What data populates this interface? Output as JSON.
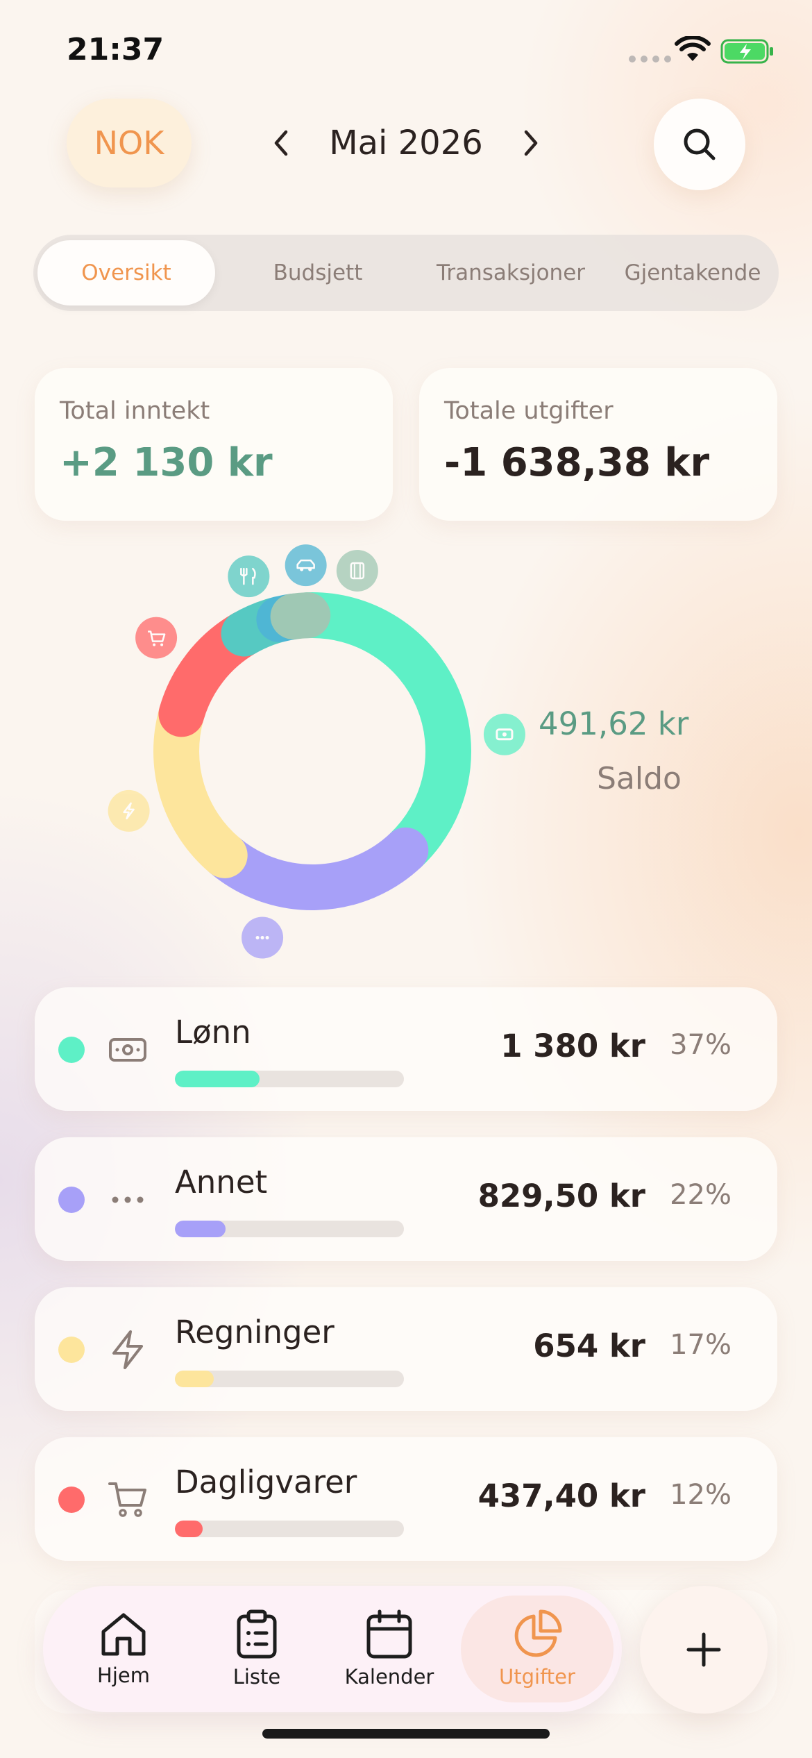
{
  "status_bar": {
    "time": "21:37"
  },
  "header": {
    "currency": "NOK",
    "month": "Mai 2026"
  },
  "tabs": [
    {
      "label": "Oversikt",
      "active": true
    },
    {
      "label": "Budsjett",
      "active": false
    },
    {
      "label": "Transaksjoner",
      "active": false
    },
    {
      "label": "Gjentakende",
      "active": false
    }
  ],
  "summary": {
    "income_label": "Total inntekt",
    "income_value": "+2 130 kr",
    "expense_label": "Totale utgifter",
    "expense_value": "-1 638,38 kr"
  },
  "balance": {
    "value": "491,62 kr",
    "label": "Saldo"
  },
  "colors": {
    "accent": "#f0954e",
    "income": "#5a9b83",
    "lonn": "#5ef0c6",
    "annet": "#a7a0f8",
    "regninger": "#fde59c",
    "dagligvarer": "#ff6b6b",
    "restaurant": "#56c9c2",
    "transport": "#4fb6d4",
    "underholdning": "#9fc8b4"
  },
  "chart_data": {
    "type": "pie",
    "donut": true,
    "title": "",
    "slices": [
      {
        "name": "Lønn",
        "value": 1380,
        "percent": 37,
        "color": "#5ef0c6",
        "icon": "banknote-icon"
      },
      {
        "name": "Annet",
        "value": 829.5,
        "percent": 22,
        "color": "#a7a0f8",
        "icon": "more-icon"
      },
      {
        "name": "Regninger",
        "value": 654,
        "percent": 17,
        "color": "#fde59c",
        "icon": "bolt-icon"
      },
      {
        "name": "Dagligvarer",
        "value": 437.4,
        "percent": 12,
        "color": "#ff6b6b",
        "icon": "cart-icon"
      },
      {
        "name": "",
        "value": 160,
        "percent": 4,
        "color": "#56c9c2",
        "icon": "fork-knife-icon"
      },
      {
        "name": "",
        "value": 60,
        "percent": 2,
        "color": "#4fb6d4",
        "icon": "car-icon"
      },
      {
        "name": "",
        "value": 60,
        "percent": 2,
        "color": "#9fc8b4",
        "icon": "film-icon"
      }
    ]
  },
  "categories": [
    {
      "name": "Lønn",
      "amount": "1 380 kr",
      "percent": "37%",
      "fill": 0.37,
      "color": "#5ef0c6",
      "icon": "banknote-icon"
    },
    {
      "name": "Annet",
      "amount": "829,50 kr",
      "percent": "22%",
      "fill": 0.22,
      "color": "#a7a0f8",
      "icon": "more-icon"
    },
    {
      "name": "Regninger",
      "amount": "654 kr",
      "percent": "17%",
      "fill": 0.17,
      "color": "#fde59c",
      "icon": "bolt-icon"
    },
    {
      "name": "Dagligvarer",
      "amount": "437,40 kr",
      "percent": "12%",
      "fill": 0.12,
      "color": "#ff6b6b",
      "icon": "cart-icon"
    }
  ],
  "tabbar": [
    {
      "label": "Hjem",
      "icon": "home-icon",
      "active": false
    },
    {
      "label": "Liste",
      "icon": "clipboard-list-icon",
      "active": false
    },
    {
      "label": "Kalender",
      "icon": "calendar-icon",
      "active": false
    },
    {
      "label": "Utgifter",
      "icon": "pie-chart-icon",
      "active": true
    }
  ]
}
